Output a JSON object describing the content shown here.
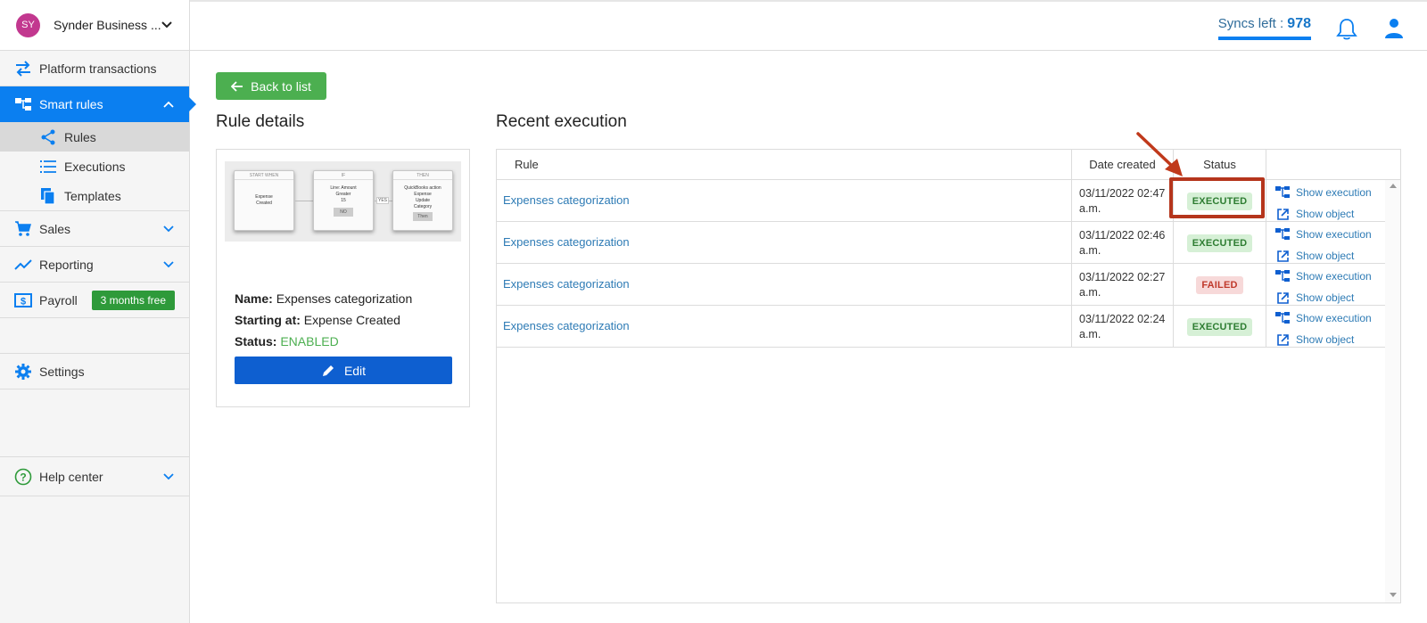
{
  "sidebar": {
    "account": {
      "initials": "SY",
      "name": "Synder Business ..."
    },
    "items": {
      "platform": {
        "label": "Platform transactions"
      },
      "smart_rules": {
        "label": "Smart rules"
      },
      "rules": {
        "label": "Rules"
      },
      "executions": {
        "label": "Executions"
      },
      "templates": {
        "label": "Templates"
      },
      "sales": {
        "label": "Sales"
      },
      "reporting": {
        "label": "Reporting"
      },
      "payroll": {
        "label": "Payroll",
        "badge": "3 months free"
      },
      "settings": {
        "label": "Settings"
      },
      "help": {
        "label": "Help center"
      }
    }
  },
  "topbar": {
    "syncs_label": "Syncs left :",
    "syncs_value": "978"
  },
  "content": {
    "back_label": "Back to list",
    "rule_details_title": "Rule details",
    "recent_title": "Recent execution"
  },
  "preview": {
    "node1": {
      "header": "START WHEN",
      "line1": "Expense",
      "line2": "Created"
    },
    "node2": {
      "header": "IF",
      "line1": "Line: Amount",
      "line2": "Greater",
      "line3": "15",
      "btn": "NO"
    },
    "node3": {
      "header": "THEN",
      "line1": "QuickBooks action",
      "line2": "Expense",
      "line3": "Update",
      "line4": "Category",
      "btn": "Then"
    },
    "yes": "YES"
  },
  "rule": {
    "name_label": "Name:",
    "name_value": "Expenses categorization",
    "start_label": "Starting at:",
    "start_value": "Expense Created",
    "status_label": "Status:",
    "status_value": "ENABLED",
    "edit_label": "Edit"
  },
  "table": {
    "headers": {
      "rule": "Rule",
      "date": "Date created",
      "status": "Status"
    },
    "rows": [
      {
        "rule": "Expenses categorization",
        "date": "03/11/2022 02:47 a.m.",
        "status": "EXECUTED",
        "show_execution": "Show execution",
        "show_object": "Show object"
      },
      {
        "rule": "Expenses categorization",
        "date": "03/11/2022 02:46 a.m.",
        "status": "EXECUTED",
        "show_execution": "Show execution",
        "show_object": "Show object"
      },
      {
        "rule": "Expenses categorization",
        "date": "03/11/2022 02:27 a.m.",
        "status": "FAILED",
        "show_execution": "Show execution",
        "show_object": "Show object"
      },
      {
        "rule": "Expenses categorization",
        "date": "03/11/2022 02:24 a.m.",
        "status": "EXECUTED",
        "show_execution": "Show execution",
        "show_object": "Show object"
      }
    ]
  },
  "colors": {
    "accent": "#0b7ff0",
    "success": "#4caf50",
    "danger": "#c0392b",
    "link": "#2e7bb5",
    "highlight": "#b5351c"
  },
  "icons": {
    "transfer": "arrows-swap-icon",
    "smart_rules": "flow-tree-icon",
    "rules": "share-nodes-icon",
    "executions": "list-icon",
    "templates": "copy-icon",
    "sales": "cart-icon",
    "reporting": "trend-line-icon",
    "payroll": "dollar-box-icon",
    "settings": "gear-icon",
    "help": "question-circle-icon"
  }
}
